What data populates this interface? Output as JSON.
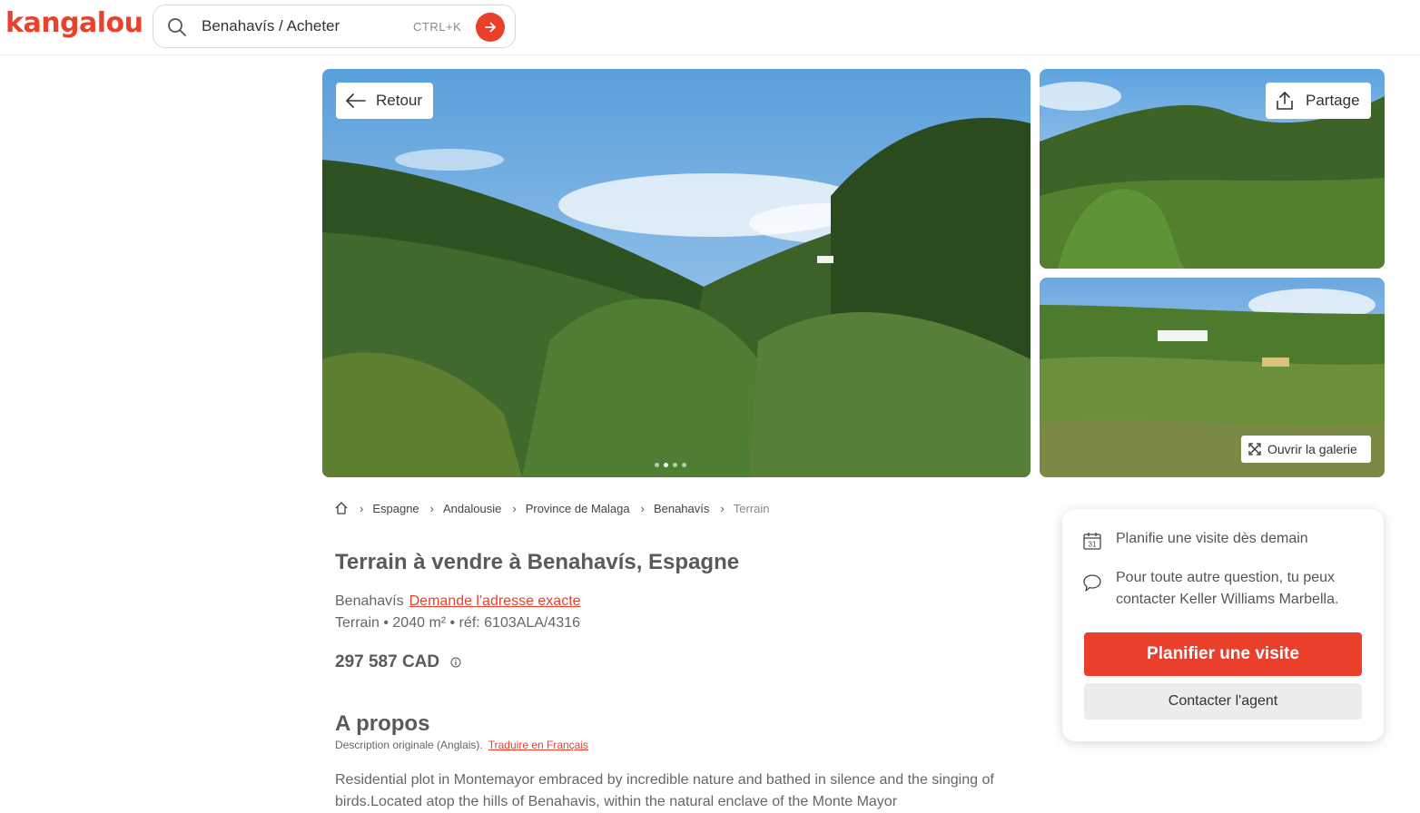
{
  "header": {
    "logo": "kangalou",
    "search": {
      "value": "Benahavís / Acheter",
      "shortcut": "CTRL+K",
      "icon": "search-icon",
      "submit_icon": "arrow-right-icon"
    }
  },
  "gallery": {
    "back_label": "Retour",
    "share_label": "Partage",
    "open_gallery_label": "Ouvrir la galerie",
    "dots_count": 4,
    "active_dot": 1
  },
  "breadcrumb": {
    "home_icon": "home-icon",
    "items": [
      "Espagne",
      "Andalousie",
      "Province de Malaga",
      "Benahavís",
      "Terrain"
    ]
  },
  "listing": {
    "title": "Terrain à vendre à Benahavís, Espagne",
    "city": "Benahavís",
    "address_link": "Demande l'adresse exacte",
    "meta": "Terrain • 2040 m² • réf: 6103ALA/4316",
    "price": "297 587 CAD"
  },
  "about": {
    "heading": "A propos",
    "original": "Description originale (Anglais).",
    "translate_link": "Traduire en Français",
    "description": "Residential plot in Montemayor embraced by incredible nature and bathed in silence and the singing of birds.Located atop the hills of Benahavis, within the natural enclave of the Monte Mayor"
  },
  "card": {
    "visit_text": "Planifie une visite dès demain",
    "question_text": "Pour toute autre question, tu peux contacter Keller Williams Marbella.",
    "plan_button": "Planifier une visite",
    "contact_button": "Contacter l'agent"
  },
  "colors": {
    "accent": "#ea3f2a",
    "logo": "#e8412c"
  }
}
